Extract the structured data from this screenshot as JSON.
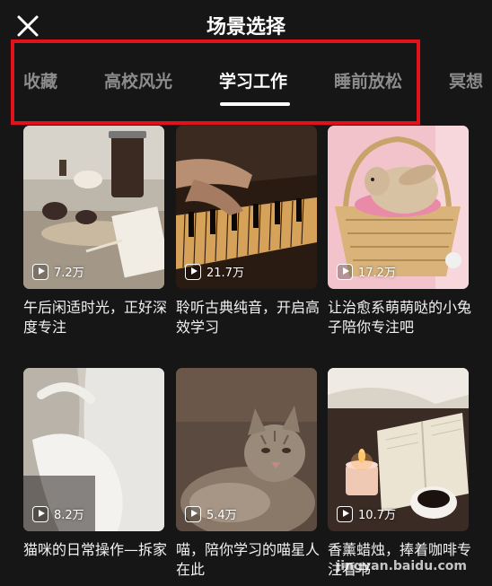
{
  "header": {
    "title": "场景选择"
  },
  "tabs": [
    {
      "label": "收藏"
    },
    {
      "label": "高校风光"
    },
    {
      "label": "学习工作"
    },
    {
      "label": "睡前放松"
    },
    {
      "label": "冥想"
    }
  ],
  "active_tab": "学习工作",
  "cards": [
    {
      "plays": "7.2万",
      "caption": "午后闲适时光，正好深度专注",
      "thumb_icon": "coffee-desk-image"
    },
    {
      "plays": "21.7万",
      "caption": "聆听古典纯音，开启高效学习",
      "thumb_icon": "piano-image"
    },
    {
      "plays": "17.2万",
      "caption": "让治愈系萌萌哒的小兔子陪你专注吧",
      "thumb_icon": "bunny-basket-image"
    },
    {
      "plays": "8.2万",
      "caption": "猫咪的日常操作—拆家",
      "thumb_icon": "white-cat-image"
    },
    {
      "plays": "5.4万",
      "caption": "喵，陪你学习的喵星人在此",
      "thumb_icon": "tabby-cat-image"
    },
    {
      "plays": "10.7万",
      "caption": "香薰蜡烛，捧着咖啡专注看书",
      "thumb_icon": "candle-book-image"
    }
  ],
  "colors": {
    "background": "#161616",
    "highlight": "#e3111b",
    "tab_inactive": "#8c8c8c"
  },
  "watermark": "jingyan.baidu.com"
}
